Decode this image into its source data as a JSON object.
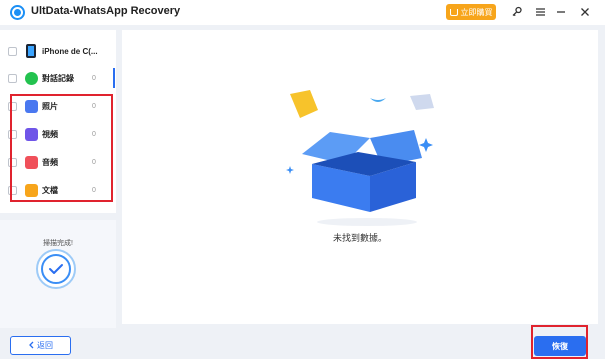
{
  "titlebar": {
    "app_title": "UltData-WhatsApp Recovery",
    "buy_label": "立即購買"
  },
  "sidebar": {
    "device_name": "iPhone de C(...",
    "items": [
      {
        "label": "對話記錄",
        "count": "0",
        "icon": "whatsapp-icon"
      },
      {
        "label": "照片",
        "count": "0",
        "icon": "photo-icon"
      },
      {
        "label": "視頻",
        "count": "0",
        "icon": "video-icon"
      },
      {
        "label": "音頻",
        "count": "0",
        "icon": "audio-icon"
      },
      {
        "label": "文檔",
        "count": "0",
        "icon": "document-icon"
      }
    ]
  },
  "scan": {
    "status_text": "掃描完成!"
  },
  "main": {
    "empty_text": "未找到數據。"
  },
  "footer": {
    "back_label": "返回",
    "recover_label": "恢復"
  },
  "colors": {
    "accent": "#2a6ef0",
    "buy": "#f7a51b",
    "highlight": "#e0232e"
  }
}
